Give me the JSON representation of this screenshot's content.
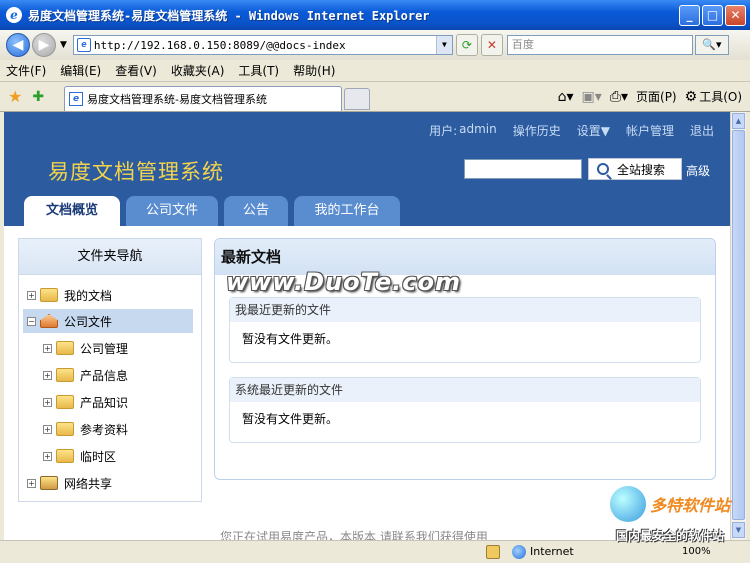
{
  "window": {
    "title": "易度文档管理系统-易度文档管理系统 - Windows Internet Explorer",
    "min": "_",
    "max": "□",
    "close": "✕"
  },
  "addressbar": {
    "url": "http://192.168.0.150:8089/@@docs-index",
    "search_placeholder": "百度",
    "refresh": "⟳",
    "stop": "✕"
  },
  "menubar": {
    "items": [
      "文件(F)",
      "编辑(E)",
      "查看(V)",
      "收藏夹(A)",
      "工具(T)",
      "帮助(H)"
    ]
  },
  "ie_tab": {
    "title": "易度文档管理系统-易度文档管理系统"
  },
  "commandbar": {
    "page": "页面(P)",
    "tools": "工具(O)"
  },
  "site": {
    "title": "易度文档管理系统",
    "user_label": "用户:",
    "user_name": "admin",
    "links": [
      "操作历史",
      "设置▼",
      "帐户管理",
      "退出"
    ],
    "search_button": "全站搜索",
    "advanced": "高级",
    "tabs": [
      "文档概览",
      "公司文件",
      "公告",
      "我的工作台"
    ]
  },
  "sidebar": {
    "title": "文件夹导航",
    "nodes": [
      {
        "label": "我的文档",
        "expander": "+"
      },
      {
        "label": "公司文件",
        "expander": "−"
      },
      {
        "label": "公司管理",
        "expander": "+"
      },
      {
        "label": "产品信息",
        "expander": "+"
      },
      {
        "label": "产品知识",
        "expander": "+"
      },
      {
        "label": "参考资料",
        "expander": "+"
      },
      {
        "label": "临时区",
        "expander": "+"
      },
      {
        "label": "网络共享",
        "expander": "+"
      }
    ]
  },
  "main": {
    "title": "最新文档",
    "box1": {
      "title": "我最近更新的文件",
      "body": "暂没有文件更新。"
    },
    "box2": {
      "title": "系统最近更新的文件",
      "body": "暂没有文件更新。"
    },
    "footer_partial": "您正在试用易度产品，本版本 请联系我们获得使用"
  },
  "watermark": "www.DuoTe.com",
  "statusbar": {
    "zone": "Internet",
    "zoom": "100%"
  },
  "brand": {
    "name": "多特软件站",
    "tagline": "国内最安全的软件站"
  }
}
